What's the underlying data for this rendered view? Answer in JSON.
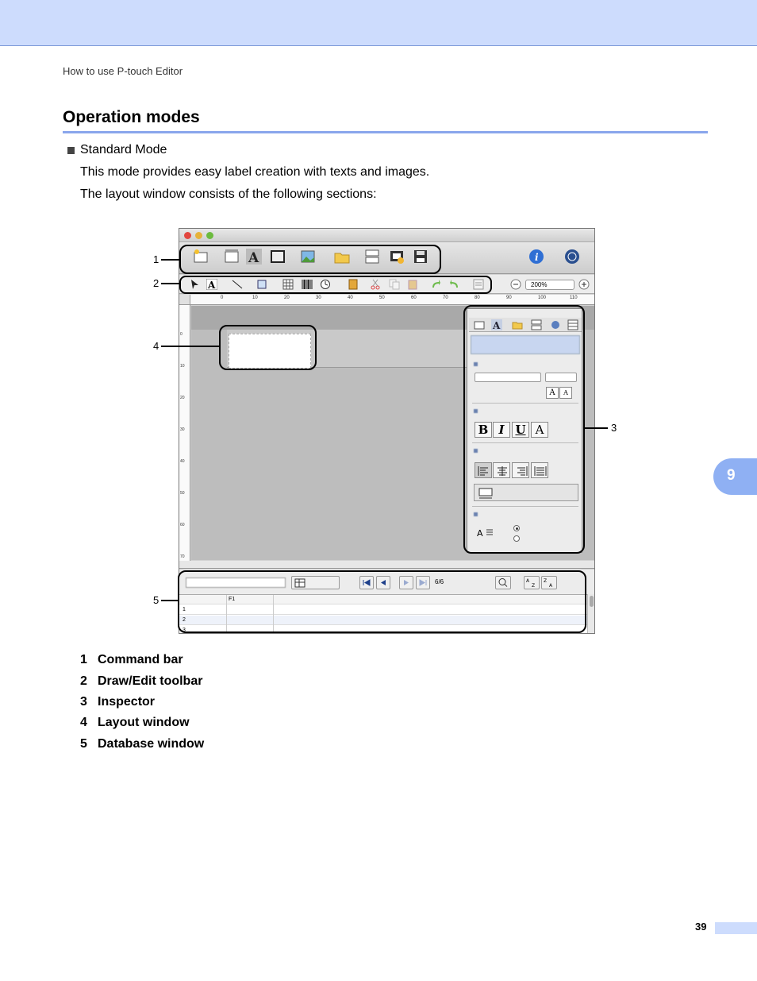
{
  "header": {
    "running_head": "How to use P-touch Editor"
  },
  "section": {
    "title": "Operation modes",
    "bullet": "Standard Mode",
    "para1": "This mode provides easy label creation with texts and images.",
    "para2": "The layout window consists of the following sections:"
  },
  "chapter_tab": "9",
  "screenshot": {
    "zoom": "200%",
    "record_count": "6/6",
    "db_column_header": "F1",
    "db_rows": [
      "1",
      "2",
      "3"
    ],
    "ruler_top": [
      "0",
      "10",
      "20",
      "30",
      "40",
      "50",
      "60",
      "70",
      "80",
      "90",
      "100",
      "110"
    ],
    "ruler_left": [
      "0",
      "10",
      "20",
      "30",
      "40",
      "50",
      "60",
      "70"
    ]
  },
  "callouts": {
    "c1": "1",
    "c2": "2",
    "c3": "3",
    "c4": "4",
    "c5": "5"
  },
  "legend": [
    {
      "num": "1",
      "label": "Command bar"
    },
    {
      "num": "2",
      "label": "Draw/Edit toolbar"
    },
    {
      "num": "3",
      "label": "Inspector"
    },
    {
      "num": "4",
      "label": "Layout window"
    },
    {
      "num": "5",
      "label": "Database window"
    }
  ],
  "footer": {
    "page_number": "39"
  },
  "colors": {
    "band": "#cddcfd",
    "rule": "#8aa6ec",
    "tab": "#8fb0f3"
  }
}
